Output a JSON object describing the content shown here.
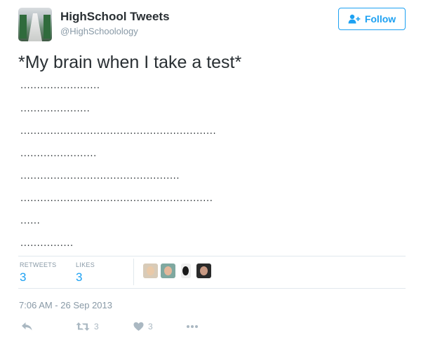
{
  "author": {
    "display_name": "HighSchool Tweets",
    "handle": "@HighSchoolology"
  },
  "follow_button": {
    "label": "Follow"
  },
  "tweet": {
    "text": "*My brain when I take a test*",
    "dot_lines": [
      "........................",
      ".....................",
      "...........................................................",
      ".......................",
      "................................................",
      "..........................................................",
      "......",
      "................"
    ]
  },
  "stats": {
    "retweets_label": "RETWEETS",
    "retweets_count": "3",
    "likes_label": "LIKES",
    "likes_count": "3"
  },
  "timestamp": "7:06 AM - 26 Sep 2013",
  "actions": {
    "reply_icon": "reply-icon",
    "retweet_count": "3",
    "like_count": "3",
    "more_icon": "more-icon"
  },
  "colors": {
    "accent": "#1da1f2",
    "text": "#292f33",
    "muted": "#8899a6",
    "action_grey": "#aab8c2"
  }
}
